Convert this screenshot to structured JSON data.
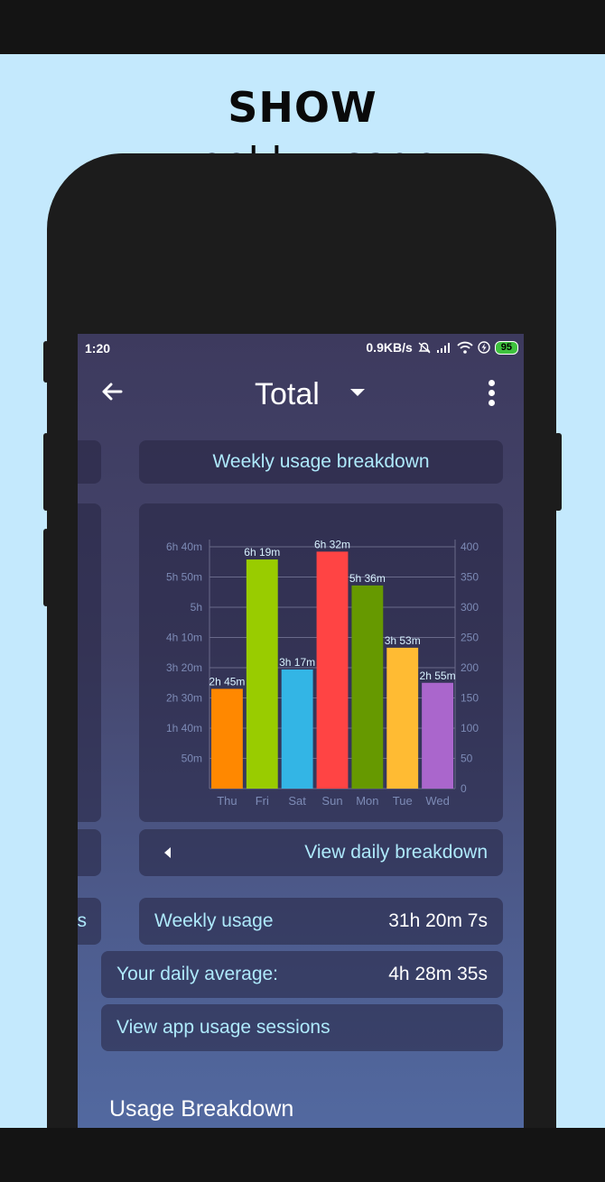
{
  "promo": {
    "headline": "SHOW",
    "subline": "weekly usage"
  },
  "status_bar": {
    "time": "1:20",
    "net_speed": "0.9KB/s",
    "battery": "95"
  },
  "app_bar": {
    "title": "Total"
  },
  "cards": {
    "weekly_breakdown": "Weekly usage breakdown",
    "view_daily": "View daily breakdown",
    "weekly_usage_label": "Weekly usage",
    "weekly_usage_value": "31h 20m 7s",
    "daily_avg_label": "Your daily average:",
    "daily_avg_value": "4h 28m 35s",
    "sessions": "View app usage sessions",
    "left_partial": "s"
  },
  "section": {
    "title": "Usage Breakdown"
  },
  "chart_data": {
    "type": "bar",
    "categories": [
      "Thu",
      "Fri",
      "Sat",
      "Sun",
      "Mon",
      "Tue",
      "Wed"
    ],
    "values": [
      165,
      379,
      197,
      392,
      336,
      233,
      175
    ],
    "data_labels": [
      "2h 45m",
      "6h 19m",
      "3h 17m",
      "6h 32m",
      "5h 36m",
      "3h 53m",
      "2h 55m"
    ],
    "colors": [
      "#ff8800",
      "#99cc00",
      "#33b5e5",
      "#ff4444",
      "#669900",
      "#ffbb33",
      "#aa66cc"
    ],
    "ylim": [
      0,
      400
    ],
    "left_ticks": [
      "",
      "50m",
      "1h 40m",
      "2h 30m",
      "3h 20m",
      "4h 10m",
      "5h",
      "5h 50m",
      "6h 40m"
    ],
    "right_ticks": [
      "0",
      "50",
      "100",
      "150",
      "200",
      "250",
      "300",
      "350",
      "400"
    ],
    "grid": true
  }
}
